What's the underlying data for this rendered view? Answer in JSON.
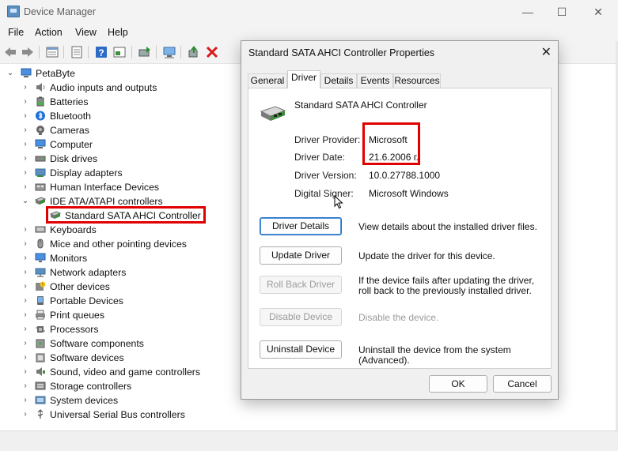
{
  "window": {
    "title": "Device Manager",
    "controls": {
      "minimize": "—",
      "maximize": "☐",
      "close": "✕"
    }
  },
  "menu": [
    "File",
    "Action",
    "View",
    "Help"
  ],
  "tree": {
    "root": "PetaByte",
    "items": [
      {
        "label": "Audio inputs and outputs",
        "icon": "speaker-icon",
        "expanded": false
      },
      {
        "label": "Batteries",
        "icon": "battery-icon",
        "expanded": false
      },
      {
        "label": "Bluetooth",
        "icon": "bluetooth-icon",
        "expanded": false
      },
      {
        "label": "Cameras",
        "icon": "camera-icon",
        "expanded": false
      },
      {
        "label": "Computer",
        "icon": "computer-icon",
        "expanded": false
      },
      {
        "label": "Disk drives",
        "icon": "disk-drive-icon",
        "expanded": false
      },
      {
        "label": "Display adapters",
        "icon": "display-adapter-icon",
        "expanded": false
      },
      {
        "label": "Human Interface Devices",
        "icon": "hid-icon",
        "expanded": false
      },
      {
        "label": "IDE ATA/ATAPI controllers",
        "icon": "ide-controller-icon",
        "expanded": true
      },
      {
        "label": "Standard SATA AHCI Controller",
        "icon": "controller-card-icon",
        "child": true
      },
      {
        "label": "Keyboards",
        "icon": "keyboard-icon",
        "expanded": false
      },
      {
        "label": "Mice and other pointing devices",
        "icon": "mouse-icon",
        "expanded": false
      },
      {
        "label": "Monitors",
        "icon": "monitor-icon",
        "expanded": false
      },
      {
        "label": "Network adapters",
        "icon": "network-adapter-icon",
        "expanded": false
      },
      {
        "label": "Other devices",
        "icon": "unknown-device-icon",
        "expanded": false
      },
      {
        "label": "Portable Devices",
        "icon": "portable-device-icon",
        "expanded": false
      },
      {
        "label": "Print queues",
        "icon": "printer-icon",
        "expanded": false
      },
      {
        "label": "Processors",
        "icon": "processor-icon",
        "expanded": false
      },
      {
        "label": "Software components",
        "icon": "software-component-icon",
        "expanded": false
      },
      {
        "label": "Software devices",
        "icon": "software-device-icon",
        "expanded": false
      },
      {
        "label": "Sound, video and game controllers",
        "icon": "sound-controller-icon",
        "expanded": false
      },
      {
        "label": "Storage controllers",
        "icon": "storage-controller-icon",
        "expanded": false
      },
      {
        "label": "System devices",
        "icon": "system-device-icon",
        "expanded": false
      },
      {
        "label": "Universal Serial Bus controllers",
        "icon": "usb-icon",
        "expanded": false
      }
    ]
  },
  "dialog": {
    "title": "Standard SATA AHCI Controller Properties",
    "close": "✕",
    "tabs": [
      "General",
      "Driver",
      "Details",
      "Events",
      "Resources"
    ],
    "active_tab": "Driver",
    "device_name": "Standard SATA AHCI Controller",
    "fields": [
      {
        "label": "Driver Provider:",
        "value": "Microsoft"
      },
      {
        "label": "Driver Date:",
        "value": "21.6.2006 г."
      },
      {
        "label": "Driver Version:",
        "value": "10.0.27788.1000"
      },
      {
        "label": "Digital Signer:",
        "value": "Microsoft Windows"
      }
    ],
    "actions": [
      {
        "button": "Driver Details",
        "desc": "View details about the installed driver files.",
        "enabled": true,
        "focused": true
      },
      {
        "button": "Update Driver",
        "desc": "Update the driver for this device.",
        "enabled": true
      },
      {
        "button": "Roll Back Driver",
        "desc": "If the device fails after updating the driver, roll back to the previously installed driver.",
        "enabled": false
      },
      {
        "button": "Disable Device",
        "desc": "Disable the device.",
        "enabled": false
      },
      {
        "button": "Uninstall Device",
        "desc": "Uninstall the device from the system (Advanced).",
        "enabled": true
      }
    ],
    "ok": "OK",
    "cancel": "Cancel"
  },
  "colors": {
    "highlight": "#e10000",
    "accent": "#2a72c4"
  }
}
